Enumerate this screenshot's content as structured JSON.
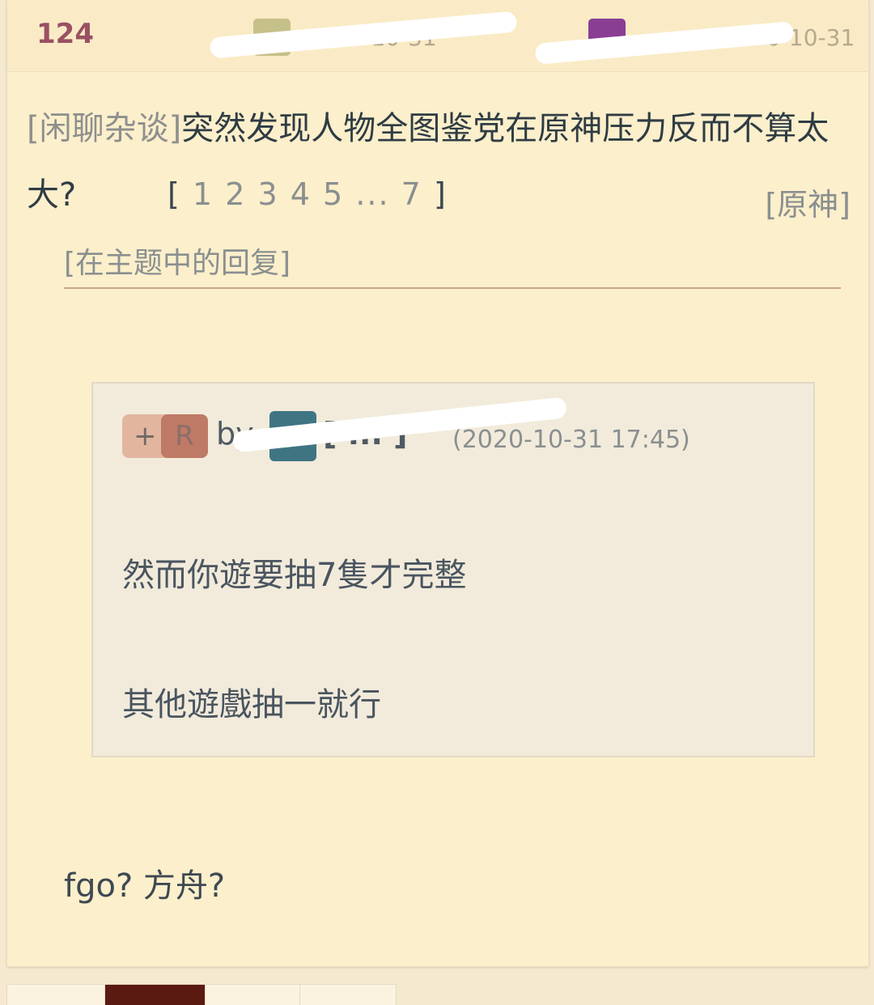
{
  "post": {
    "floor": "124",
    "author_a_date": "2020-10-31",
    "author_b_date": "0-10-31"
  },
  "thread": {
    "category": "[闲聊杂谈]",
    "title": "突然发现人物全图鉴党在原神压力反而不算太大?",
    "pager": {
      "open": "[",
      "pages": [
        "1",
        "2",
        "3",
        "4",
        "5",
        "...",
        "7"
      ],
      "close": "]"
    },
    "forum": "[原神]"
  },
  "reply_note": "[在主题中的回复]",
  "quote": {
    "plus_label": "+",
    "r_label": "R",
    "by_label": "by",
    "quoted_name": "[ ... ]",
    "time": "(2020-10-31 17:45)",
    "lines": [
      "然而你遊要抽7隻才完整",
      "其他遊戲抽一就行"
    ]
  },
  "reply": {
    "body": "fgo? 方舟?"
  },
  "colors": {
    "floor": "#9a5063",
    "card_bg": "#fcefcb",
    "quote_bg": "#f2ebdb",
    "active_tab": "#5a1a12"
  }
}
